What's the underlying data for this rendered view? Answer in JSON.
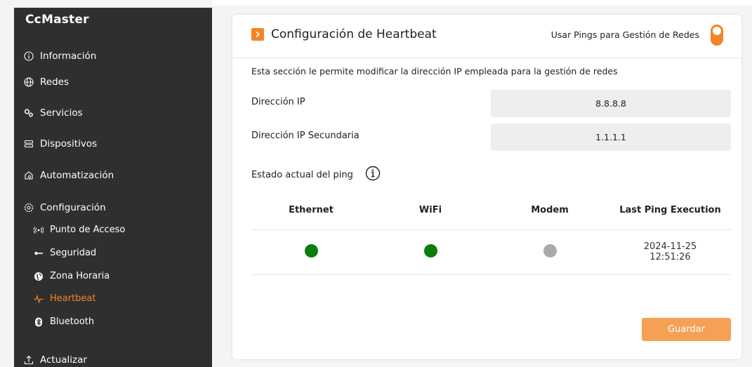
{
  "sidebar": {
    "brand": "CcMaster",
    "items": [
      {
        "label": "Información",
        "icon": "info-icon"
      },
      {
        "label": "Redes",
        "icon": "globe-icon"
      },
      {
        "label": "Servicios",
        "icon": "gears-icon"
      },
      {
        "label": "Dispositivos",
        "icon": "devices-icon"
      },
      {
        "label": "Automatización",
        "icon": "automation-icon"
      },
      {
        "label": "Configuración",
        "icon": "gear-icon"
      },
      {
        "label": "Actualizar",
        "icon": "upload-icon"
      }
    ],
    "sub_items": [
      {
        "label": "Punto de Acceso",
        "icon": "broadcast-icon"
      },
      {
        "label": "Seguridad",
        "icon": "key-icon"
      },
      {
        "label": "Zona Horaria",
        "icon": "world-icon"
      },
      {
        "label": "Heartbeat",
        "icon": "heartbeat-icon",
        "active": true
      },
      {
        "label": "Bluetooth",
        "icon": "bluetooth-icon"
      }
    ]
  },
  "card": {
    "title": "Configuración de Heartbeat",
    "switch_label": "Usar Pings para Gestión de Redes",
    "description": "Esta sección le permite modificar la dirección IP empleada para la gestión de redes",
    "ip_label": "Dirección IP",
    "ip_value": "8.8.8.8",
    "ip2_label": "Dirección IP Secundaria",
    "ip2_value": "1.1.1.1",
    "ping_label": "Estado actual del ping",
    "table": {
      "headers": [
        "Ethernet",
        "WiFi",
        "Modem",
        "Last Ping Execution"
      ],
      "row": {
        "ethernet_status": "#0a7d0a",
        "wifi_status": "#0a7d0a",
        "modem_status": "#aaaaaa",
        "last_ping_date": "2024-11-25",
        "last_ping_time": "12:51:26"
      }
    },
    "save_label": "Guardar"
  },
  "colors": {
    "accent": "#f58426",
    "sidebar_bg": "#2f2f2f",
    "status_ok": "#0a7d0a",
    "status_off": "#aaaaaa"
  }
}
